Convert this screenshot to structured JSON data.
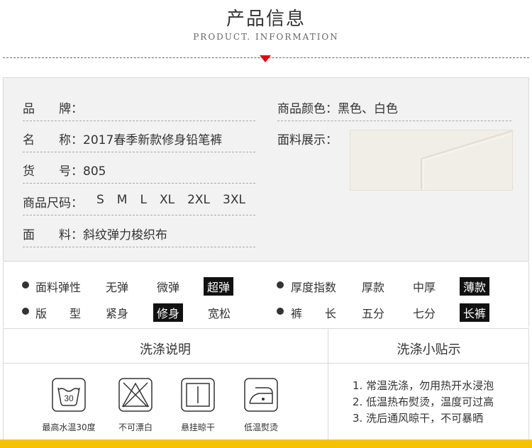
{
  "header": {
    "title": "产品信息",
    "subtitle": "PRODUCT. INFORMATION"
  },
  "colors": {
    "accent": "#e60012",
    "tag_bg": "#111111",
    "footer_bar": "#f6c200"
  },
  "specs": {
    "brand": {
      "label": "品　　牌：",
      "value": ""
    },
    "name": {
      "label": "名　　称：",
      "value": "2017春季新款修身铅笔裤"
    },
    "item_no": {
      "label": "货　　号：",
      "value": "805"
    },
    "size": {
      "label": "商品尺码：",
      "values": [
        "S",
        "M",
        "L",
        "XL",
        "2XL",
        "3XL"
      ]
    },
    "material": {
      "label": "面　　料：",
      "value": "斜纹弹力梭织布"
    },
    "color": {
      "label": "商品颜色：",
      "value": "黑色、白色"
    },
    "fabric": {
      "label": "面料展示："
    }
  },
  "attributes": {
    "elasticity": {
      "label": "面料弹性",
      "options": [
        "无弹",
        "微弹",
        "超弹"
      ],
      "selected": "超弹"
    },
    "thickness": {
      "label": "厚度指数",
      "options": [
        "厚款",
        "中厚",
        "薄款"
      ],
      "selected": "薄款"
    },
    "fit": {
      "label": "版　　型",
      "options": [
        "紧身",
        "修身",
        "宽松"
      ],
      "selected": "修身"
    },
    "length": {
      "label": "裤　　长",
      "options": [
        "五分",
        "七分",
        "长裤"
      ],
      "selected": "长裤"
    }
  },
  "washing": {
    "title": "洗涤说明",
    "icons": [
      {
        "icon": "wash-30-icon",
        "number": "30",
        "label": "最高水温30度"
      },
      {
        "icon": "no-bleach-icon",
        "label": "不可漂白"
      },
      {
        "icon": "hang-dry-icon",
        "label": "悬挂晾干"
      },
      {
        "icon": "low-iron-icon",
        "label": "低温熨烫"
      }
    ]
  },
  "tips": {
    "title": "洗涤小贴示",
    "items": [
      "1. 常温洗涤，勿用热开水浸泡",
      "2. 低温热布熨烫，温度可过高",
      "3. 洗后通风晾干，不可暴晒"
    ]
  }
}
